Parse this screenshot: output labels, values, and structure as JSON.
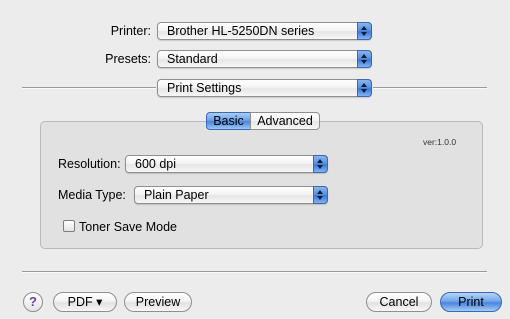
{
  "printer": {
    "label": "Printer:",
    "value": "Brother HL-5250DN series"
  },
  "presets": {
    "label": "Presets:",
    "value": "Standard"
  },
  "panel_select": {
    "value": "Print Settings"
  },
  "tabs": [
    {
      "label": "Basic",
      "selected": true
    },
    {
      "label": "Advanced",
      "selected": false
    }
  ],
  "version": "ver:1.0.0",
  "resolution": {
    "label": "Resolution:",
    "value": "600 dpi"
  },
  "media_type": {
    "label": "Media Type:",
    "value": "Plain Paper"
  },
  "toner_save": {
    "label": "Toner Save Mode",
    "checked": false
  },
  "footer": {
    "help_label": "?",
    "pdf_label": "PDF ▾",
    "preview_label": "Preview",
    "cancel_label": "Cancel",
    "print_label": "Print"
  }
}
